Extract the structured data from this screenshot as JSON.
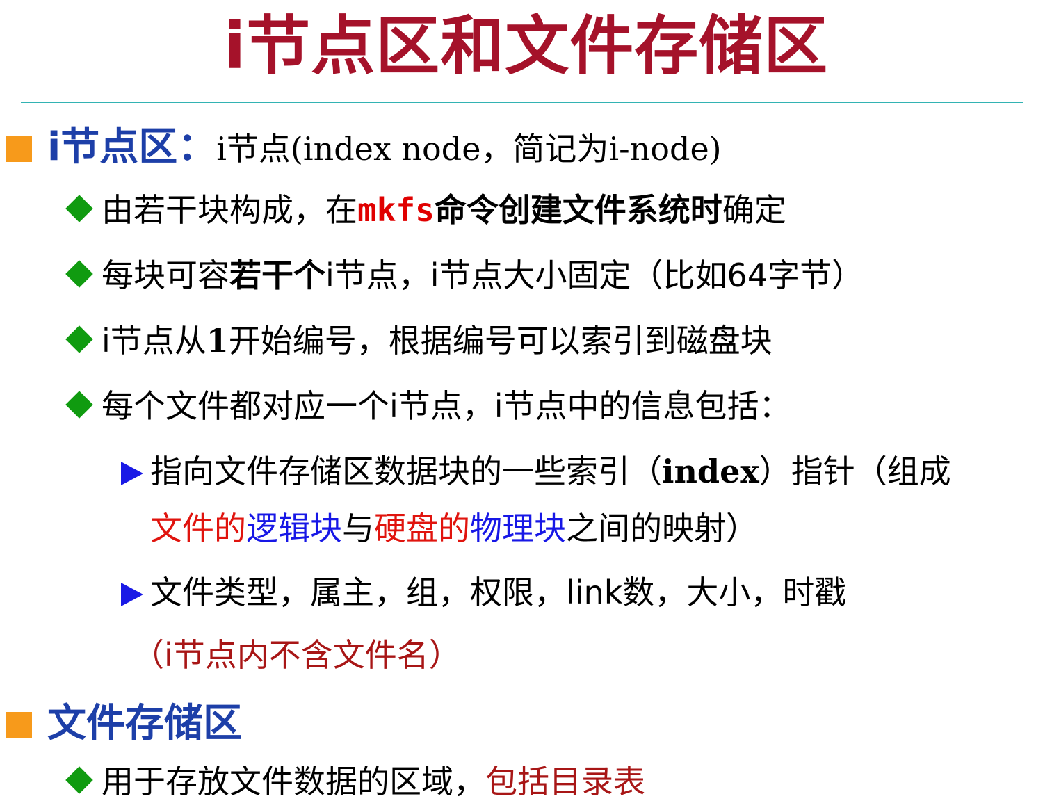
{
  "title": "i节点区和文件存储区",
  "section1": {
    "heading": "i节点区：",
    "heading_rest": "i节点(index node，简记为i-node)",
    "item1": {
      "a": "由若干块构成，在",
      "cmd": "mkfs",
      "b": "命令创建文件系统时",
      "c": "确定"
    },
    "item2": {
      "a": "每块可容",
      "b": "若干个",
      "c": "i节点，i节点大小固定（比如64字节）"
    },
    "item3": {
      "a": "i节点从",
      "b": "1",
      "c": "开始编号，根据编号可以索引到磁盘块"
    },
    "item4": {
      "a": "每个文件都对应一个i节点，i节点中的信息包括："
    },
    "sub1": {
      "a": "指向文件存储区数据块的一些索引（",
      "b": "index",
      "c": "）指针（组成",
      "d": "文件的",
      "e": "逻辑块",
      "f": "与",
      "g": "硬盘的",
      "h": "物理块",
      "i": "之间的映射）"
    },
    "sub2": {
      "a": "文件类型，属主，组，权限，link数，大小，时戳",
      "note": "（i节点内不含文件名）"
    }
  },
  "section2": {
    "heading": "文件存储区",
    "item1": {
      "a": "用于存放文件数据的区域，",
      "b": "包括目录表"
    }
  }
}
